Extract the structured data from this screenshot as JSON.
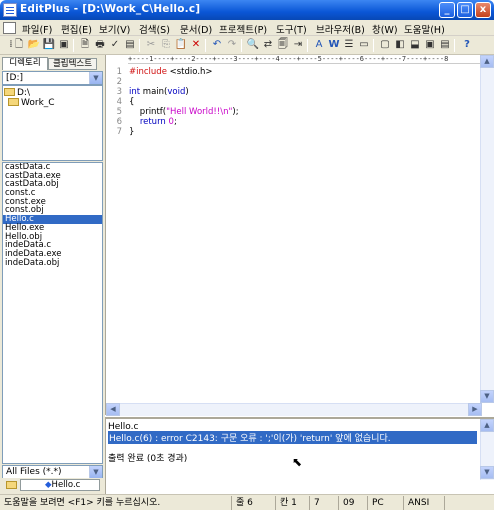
{
  "window": {
    "title": "EditPlus - [D:\\Work_C\\Hello.c]",
    "min_label": "_",
    "max_label": "□",
    "close_label": "x"
  },
  "menu": [
    "파일(F)",
    "편집(E)",
    "보기(V)",
    "검색(S)",
    "문서(D)",
    "프로젝트(P)",
    "도구(T)",
    "브라우저(B)",
    "창(W)",
    "도움말(H)"
  ],
  "sidebar": {
    "tabs": [
      "디렉토리",
      "클립텍스트"
    ],
    "drive": "[D:]",
    "tree": [
      "D:\\",
      "Work_C"
    ],
    "files": [
      "castData.c",
      "castData.exe",
      "castData.obj",
      "const.c",
      "const.exe",
      "const.obj",
      "Hello.c",
      "Hello.exe",
      "Hello.obj",
      "indeData.c",
      "indeData.exe",
      "indeData.obj"
    ],
    "selected_file": "Hello.c",
    "filter": "All Files (*.*)",
    "open_tab": "Hello.c"
  },
  "editor": {
    "ruler": "+----1----+----2----+----3----+----4----+----5----+----6----+----7----+----8",
    "line_numbers": [
      "1",
      "2",
      "3",
      "4",
      "5",
      "6",
      "7"
    ],
    "code": {
      "l1_directive": "#include",
      "l1_header": " <stdio.h>",
      "l3_type": "int",
      "l3_rest": " main(",
      "l3_void": "void",
      "l3_close": ")",
      "l4": "{",
      "l5_fn": "    printf(",
      "l5_str": "\"Hell World!!\\n\"",
      "l5_end": ");",
      "l6_indent": "    ",
      "l6_kw": "return",
      "l6_num": " 0",
      "l6_end": ";",
      "l7": "}"
    }
  },
  "output": {
    "lines": [
      "Hello.c",
      "Hello.c(6) : error C2143: 구문 오류 : ';'이(가) 'return' 앞에 없습니다.",
      "",
      "출력 완료 (0초 경과)"
    ],
    "selected_line": 1
  },
  "statusbar": {
    "help": "도움말을 보려면 <F1> 키를 누르십시오.",
    "line": "줄 6",
    "col": "칸 1",
    "num1": "7",
    "num2": "09",
    "mode": "PC",
    "encoding": "ANSI"
  },
  "colors": {
    "titlebar": "#0a56d6",
    "selection": "#316ac5",
    "chrome": "#ece9d8"
  }
}
